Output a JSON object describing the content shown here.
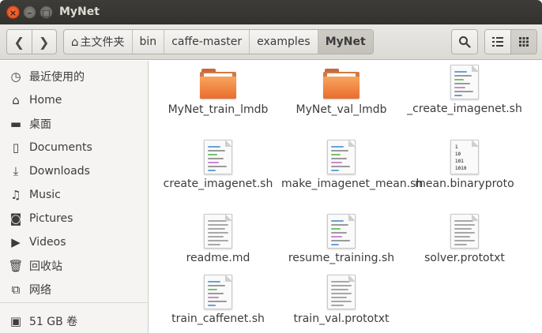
{
  "window": {
    "title": "MyNet",
    "close_glyph": "×",
    "min_glyph": "–",
    "max_glyph": "□"
  },
  "toolbar": {
    "back_glyph": "❮",
    "forward_glyph": "❯",
    "breadcrumbs": [
      {
        "label": "主文件夹",
        "icon": "home-icon"
      },
      {
        "label": "bin"
      },
      {
        "label": "caffe-master"
      },
      {
        "label": "examples"
      },
      {
        "label": "MyNet"
      }
    ],
    "search_icon": "search-icon",
    "list_view_icon": "list-view-icon",
    "grid_view_icon": "grid-view-icon"
  },
  "sidebar": {
    "items": [
      {
        "label": "最近使用的",
        "icon": "clock-icon",
        "glyph": "◷"
      },
      {
        "label": "Home",
        "icon": "home-icon",
        "glyph": "⌂"
      },
      {
        "label": "桌面",
        "icon": "desktop-folder-icon",
        "glyph": "▬"
      },
      {
        "label": "Documents",
        "icon": "document-icon",
        "glyph": "▯"
      },
      {
        "label": "Downloads",
        "icon": "download-icon",
        "glyph": "⤓"
      },
      {
        "label": "Music",
        "icon": "music-icon",
        "glyph": "♫"
      },
      {
        "label": "Pictures",
        "icon": "camera-icon",
        "glyph": "◙"
      },
      {
        "label": "Videos",
        "icon": "video-icon",
        "glyph": "▶"
      },
      {
        "label": "回收站",
        "icon": "trash-icon",
        "glyph": "🗑"
      },
      {
        "label": "网络",
        "icon": "network-icon",
        "glyph": "⧉"
      },
      {
        "label": "51 GB 卷",
        "icon": "drive-icon",
        "glyph": "▣"
      }
    ]
  },
  "files": [
    {
      "name": "MyNet_train_lmdb",
      "kind": "folder"
    },
    {
      "name": "MyNet_val_lmdb",
      "kind": "folder"
    },
    {
      "name": "_create_imagenet.sh",
      "kind": "script"
    },
    {
      "name": "create_imagenet.sh",
      "kind": "script"
    },
    {
      "name": "make_imagenet_mean.sh",
      "kind": "script"
    },
    {
      "name": "mean.binaryproto",
      "kind": "binary",
      "binary_lines": [
        "1",
        "10",
        "101",
        "1010"
      ]
    },
    {
      "name": "readme.md",
      "kind": "text"
    },
    {
      "name": "resume_training.sh",
      "kind": "script"
    },
    {
      "name": "solver.prototxt",
      "kind": "text"
    },
    {
      "name": "train_caffenet.sh",
      "kind": "script"
    },
    {
      "name": "train_val.prototxt",
      "kind": "text"
    }
  ],
  "colors": {
    "folder_orange": "#f08a45",
    "active_crumb": "#c9c6c0",
    "titlebar": "#3a3935"
  }
}
